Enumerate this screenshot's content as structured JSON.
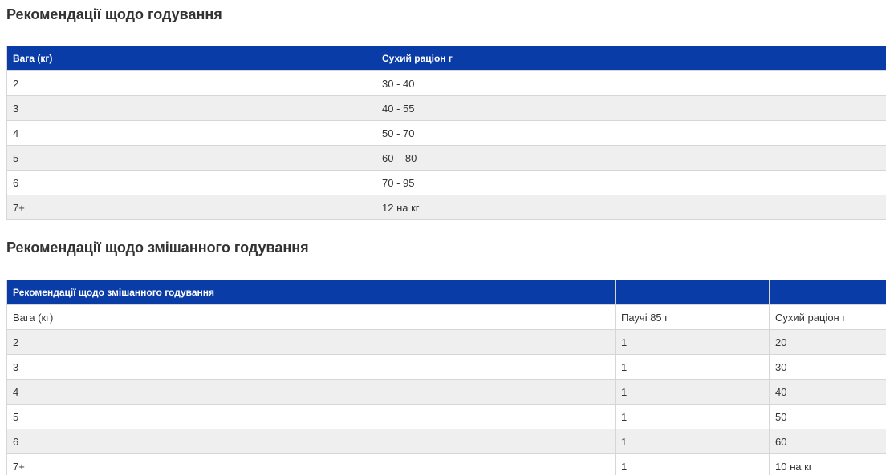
{
  "feeding": {
    "title": "Рекомендації щодо годування",
    "headers": [
      "Вага (кг)",
      "Сухий раціон г"
    ],
    "rows": [
      [
        "2",
        "30 - 40"
      ],
      [
        "3",
        "40 - 55"
      ],
      [
        "4",
        "50 - 70"
      ],
      [
        "5",
        "60 – 80"
      ],
      [
        "6",
        "70 - 95"
      ],
      [
        "7+",
        "12 на кг"
      ]
    ]
  },
  "mixed": {
    "title": "Рекомендації щодо змішанного годування",
    "headers": [
      "Рекомендації щодо змішанного годування",
      "",
      ""
    ],
    "subheaders": [
      "Вага (кг)",
      "Паучі 85 г",
      "Сухий раціон г"
    ],
    "rows": [
      [
        "2",
        "1",
        "20"
      ],
      [
        "3",
        "1",
        "30"
      ],
      [
        "4",
        "1",
        "40"
      ],
      [
        "5",
        "1",
        "50"
      ],
      [
        "6",
        "1",
        "60"
      ],
      [
        "7+",
        "1",
        "10 на кг"
      ]
    ]
  },
  "colors": {
    "header_bg": "#0a3ca8",
    "stripe_bg": "#efefef"
  }
}
